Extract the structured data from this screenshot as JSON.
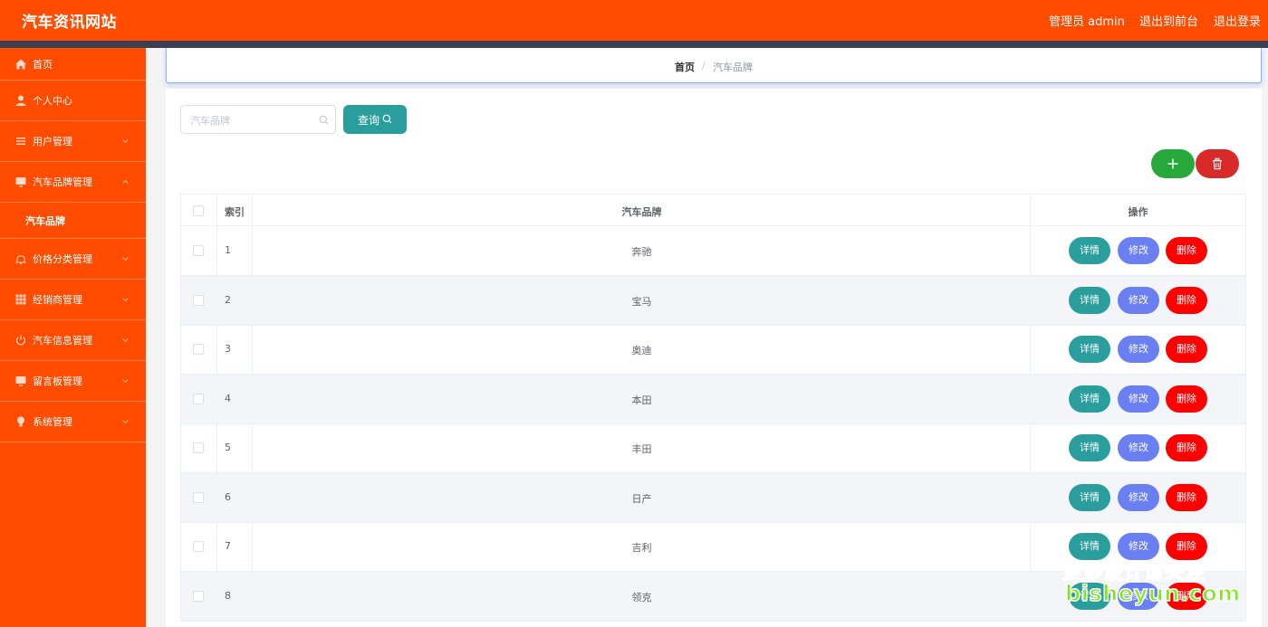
{
  "header": {
    "title": "汽车资讯网站",
    "admin_label": "管理员 admin",
    "front_label": "退出到前台",
    "logout_label": "退出登录"
  },
  "sidebar": {
    "items": [
      {
        "label": "首页",
        "icon": "home-icon"
      },
      {
        "label": "个人中心",
        "icon": "user-icon"
      },
      {
        "label": "用户管理",
        "icon": "list-icon"
      },
      {
        "label": "汽车品牌管理",
        "icon": "monitor-icon"
      },
      {
        "label": "价格分类管理",
        "icon": "bell-icon"
      },
      {
        "label": "经销商管理",
        "icon": "grid-icon"
      },
      {
        "label": "汽车信息管理",
        "icon": "power-icon"
      },
      {
        "label": "留言板管理",
        "icon": "monitor-icon"
      },
      {
        "label": "系统管理",
        "icon": "bulb-icon"
      }
    ],
    "sub_item": "汽车品牌"
  },
  "breadcrumb": {
    "home": "首页",
    "separator": "/",
    "current": "汽车品牌"
  },
  "search": {
    "placeholder": "汽车品牌",
    "button_label": "查询"
  },
  "table": {
    "headers": {
      "index": "索引",
      "brand": "汽车品牌",
      "actions": "操作"
    },
    "rows": [
      {
        "index": "1",
        "brand": "奔驰"
      },
      {
        "index": "2",
        "brand": "宝马"
      },
      {
        "index": "3",
        "brand": "奥迪"
      },
      {
        "index": "4",
        "brand": "本田"
      },
      {
        "index": "5",
        "brand": "丰田"
      },
      {
        "index": "6",
        "brand": "日产"
      },
      {
        "index": "7",
        "brand": "吉利"
      },
      {
        "index": "8",
        "brand": "领克"
      }
    ],
    "actions": {
      "detail": "详情",
      "edit": "修改",
      "remove": "删除"
    }
  },
  "watermark": {
    "line1": "更多设计请关注",
    "line2": "bisheyun.com"
  },
  "colors": {
    "accent": "#ff4c00",
    "teal": "#2a9d9d",
    "edit": "#6a7ff2",
    "danger": "#ff0000",
    "add": "#27a83a"
  }
}
